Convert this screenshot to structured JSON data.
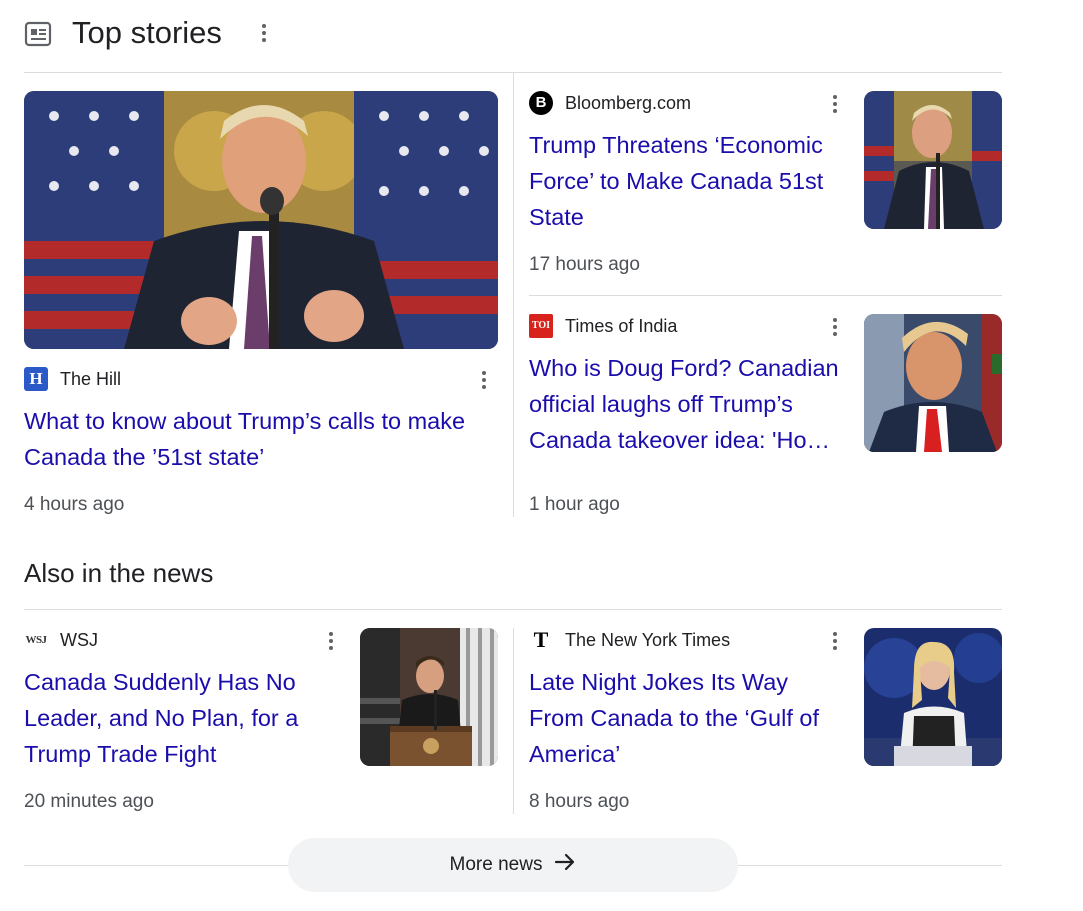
{
  "top_stories": {
    "title": "Top stories",
    "main_story": {
      "source": "The Hill",
      "logo_letter": "H",
      "headline": "What to know about Trump’s calls to make Canada the ’51st state’",
      "time": "4 hours ago"
    },
    "side_stories": [
      {
        "source": "Bloomberg.com",
        "logo_letter": "B",
        "headline": "Trump Threatens ‘Economic Force’ to Make Canada 51st State",
        "time": "17 hours ago"
      },
      {
        "source": "Times of India",
        "logo_letter": "TOI",
        "headline": "Who is Doug Ford? Canadian official laughs off Trump’s Canada takeover idea: 'Ho…",
        "time": "1 hour ago"
      }
    ]
  },
  "also_in_news": {
    "title": "Also in the news",
    "stories": [
      {
        "source": "WSJ",
        "logo_letter": "WSJ",
        "headline": "Canada Suddenly Has No Leader, and No Plan, for a Trump Trade Fight",
        "time": "20 minutes ago"
      },
      {
        "source": "The New York Times",
        "logo_letter": "T",
        "headline": "Late Night Jokes Its Way From Canada to the ‘Gulf of America’",
        "time": "8 hours ago"
      }
    ]
  },
  "more_news": {
    "label": "More news"
  },
  "colors": {
    "link": "#1a0dab",
    "divider": "#dadce0",
    "hill_blue": "#2b5ac8",
    "toi_red": "#d8231c"
  }
}
